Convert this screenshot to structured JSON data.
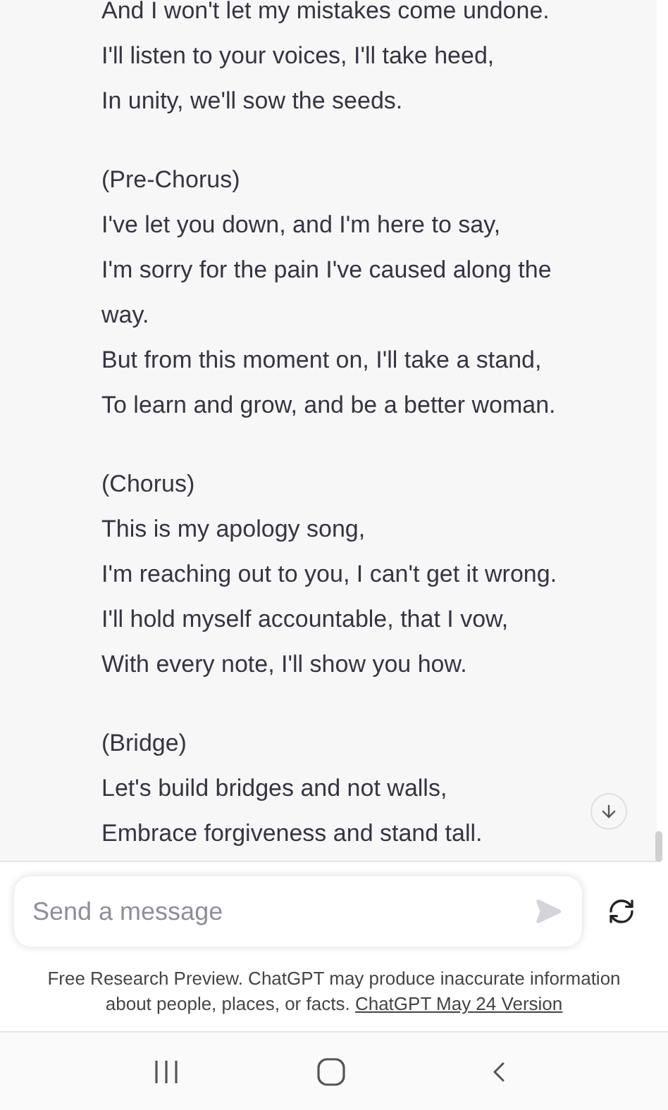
{
  "stanzas": [
    {
      "lines": [
        "And I won't let my mistakes come undone.",
        "I'll listen to your voices, I'll take heed,",
        "In unity, we'll sow the seeds."
      ]
    },
    {
      "lines": [
        "(Pre-Chorus)",
        "I've let you down, and I'm here to say,",
        "I'm sorry for the pain I've caused along the",
        "way.",
        "But from this moment on, I'll take a stand,",
        "To learn and grow, and be a better woman."
      ]
    },
    {
      "lines": [
        "(Chorus)",
        "This is my apology song,",
        "I'm reaching out to you, I can't get it wrong.",
        "I'll hold myself accountable, that I vow,",
        "With every note, I'll show you how."
      ]
    },
    {
      "lines": [
        "(Bridge)",
        "Let's build bridges and not walls,",
        "Embrace forgiveness and stand tall."
      ]
    }
  ],
  "composer": {
    "placeholder": "Send a message"
  },
  "disclaimer": {
    "text": "Free Research Preview. ChatGPT may produce inaccurate information about people, places, or facts.",
    "link": "ChatGPT May 24 Version"
  }
}
